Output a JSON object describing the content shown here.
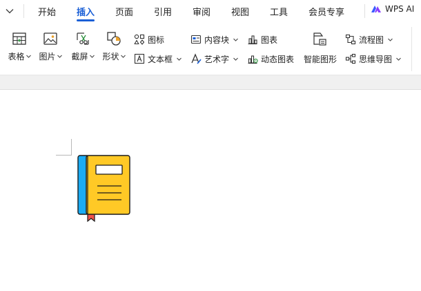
{
  "menubar": {
    "tabs": [
      {
        "label": "开始"
      },
      {
        "label": "插入",
        "active": true
      },
      {
        "label": "页面"
      },
      {
        "label": "引用"
      },
      {
        "label": "审阅"
      },
      {
        "label": "视图"
      },
      {
        "label": "工具"
      },
      {
        "label": "会员专享"
      }
    ],
    "ai_label": "WPS AI",
    "accent_color": "#1a5fd6"
  },
  "ribbon": {
    "table": "表格",
    "picture": "图片",
    "screenshot": "截屏",
    "shape": "形状",
    "icon": "图标",
    "textbox": "文本框",
    "content_block": "内容块",
    "wordart": "艺术字",
    "chart": "图表",
    "dynamic_chart": "动态图表",
    "smart_graphic": "智能图形",
    "flowchart": "流程图",
    "mindmap": "思维导图"
  },
  "document": {
    "icons": [
      "book-icon"
    ],
    "book_colors": {
      "cover": "#FFC926",
      "spine": "#1AACF5",
      "ribbon": "#F0524A",
      "outline": "#1a1a1a"
    }
  }
}
